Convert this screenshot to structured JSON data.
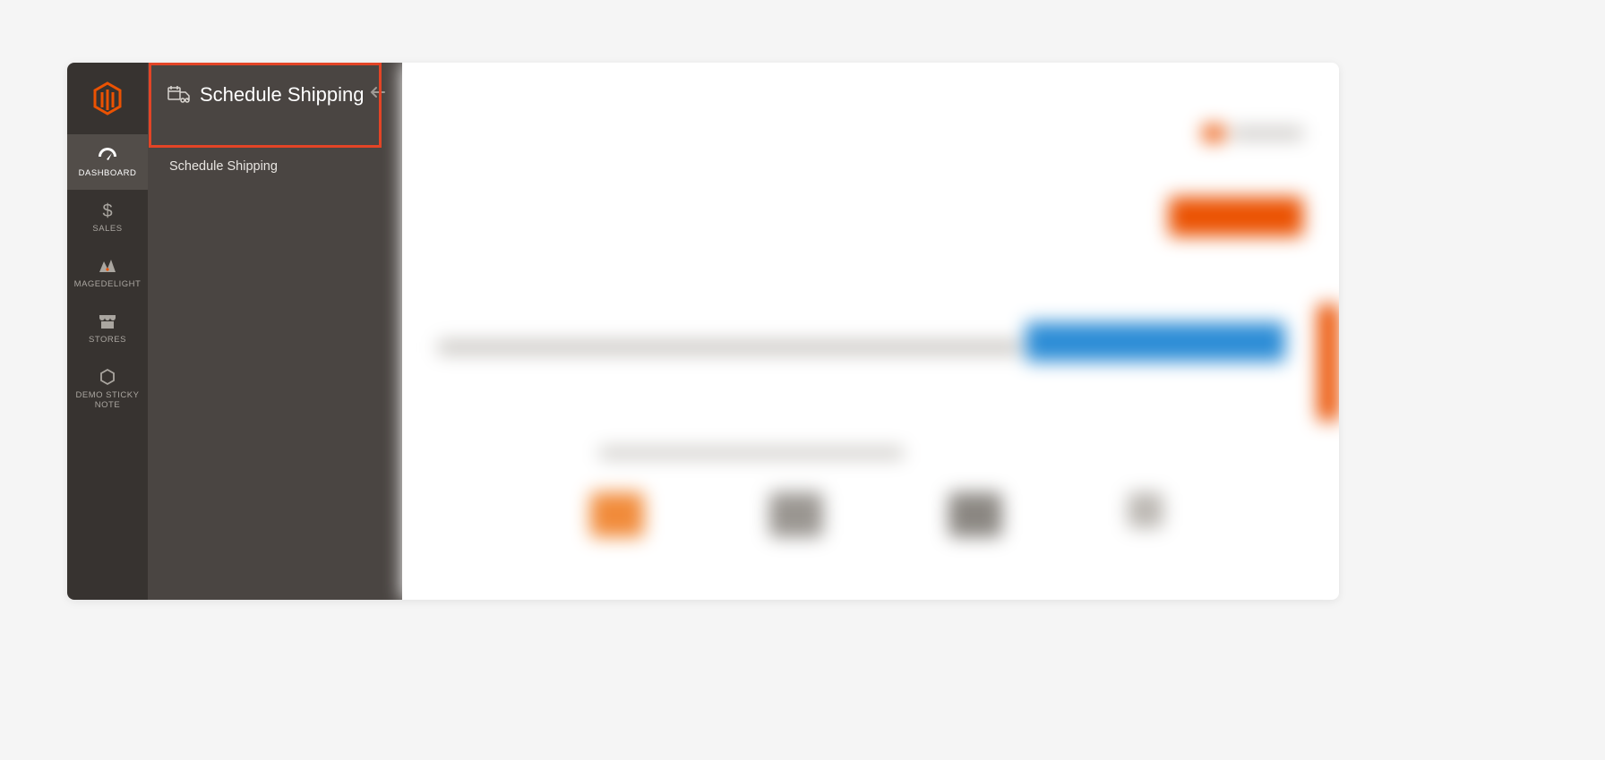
{
  "sidebar": {
    "items": [
      {
        "label": "DASHBOARD"
      },
      {
        "label": "SALES"
      },
      {
        "label": "MAGEDELIGHT"
      },
      {
        "label": "STORES"
      },
      {
        "label": "DEMO STICKY NOTE"
      }
    ]
  },
  "flyout": {
    "title": "Schedule Shipping",
    "submenu": [
      {
        "label": "Schedule Shipping"
      }
    ]
  }
}
